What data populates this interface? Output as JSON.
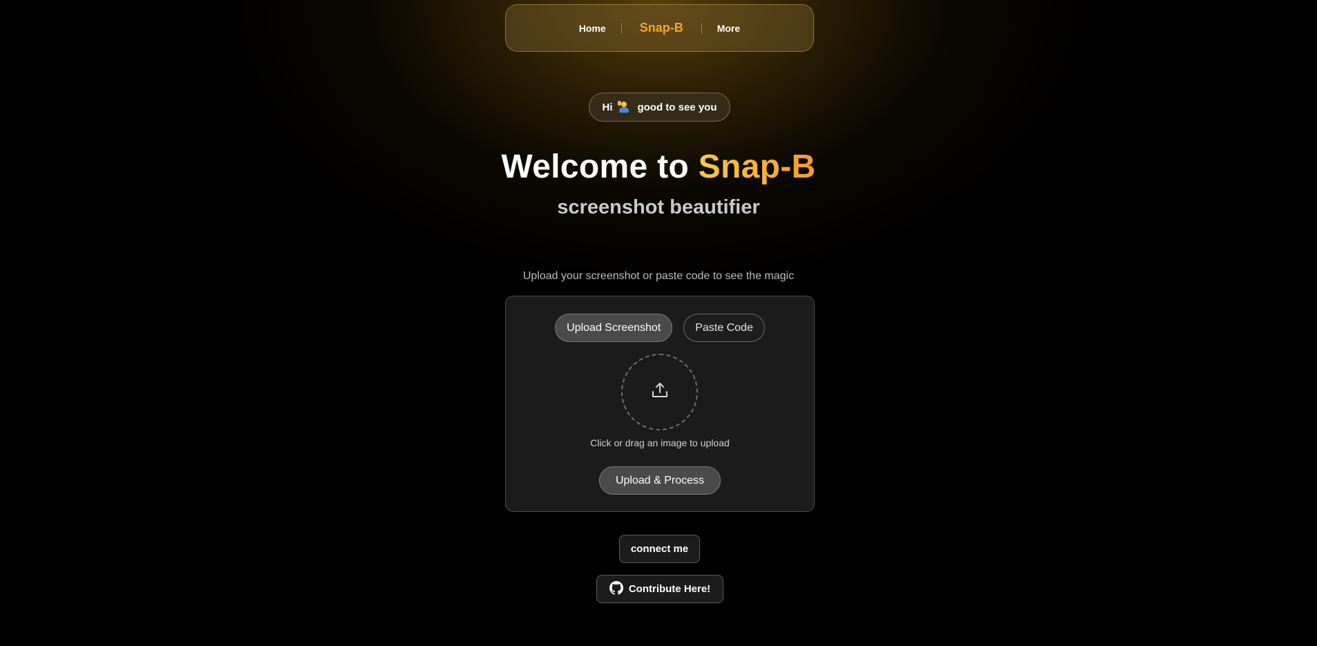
{
  "navbar": {
    "home_label": "Home",
    "brand_label": "Snap-B",
    "more_label": "More"
  },
  "greeting": {
    "hi": "Hi",
    "message": "good to see you",
    "emoji_icon": "waving-person-icon"
  },
  "hero": {
    "title_prefix": "Welcome to",
    "title_accent": "Snap-B",
    "subtitle": "screenshot beautifier",
    "tagline": "Upload your screenshot or paste code to see the magic"
  },
  "uploader": {
    "tabs": [
      {
        "label": "Upload Screenshot",
        "active": true
      },
      {
        "label": "Paste Code",
        "active": false
      }
    ],
    "drop_icon": "upload-tray-icon",
    "drop_hint": "Click or drag an image to upload",
    "process_label": "Upload & Process"
  },
  "footer": {
    "connect_label": "connect me",
    "contribute_label": "Contribute Here!",
    "contribute_icon": "github-icon"
  },
  "colors": {
    "accent_start": "#f7c948",
    "accent_end": "#f39c27",
    "brand": "#f4a52a",
    "card_bg": "#1b1b1b"
  }
}
